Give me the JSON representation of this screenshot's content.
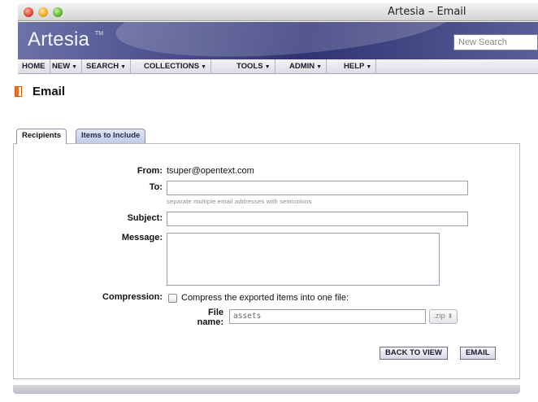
{
  "window": {
    "title": "Artesia – Email"
  },
  "banner": {
    "logo": "Artesia",
    "logo_tm": "TM",
    "search_placeholder": "New Search"
  },
  "menu": [
    {
      "label": "HOME",
      "caret": ""
    },
    {
      "label": "NEW",
      "caret": "▼"
    },
    {
      "label": "SEARCH",
      "caret": "▼"
    },
    {
      "label": "COLLECTIONS",
      "caret": "▼"
    },
    {
      "label": "TOOLS",
      "caret": "▼"
    },
    {
      "label": "ADMIN",
      "caret": "▼"
    },
    {
      "label": "HELP",
      "caret": "▼"
    }
  ],
  "page": {
    "title": "Email"
  },
  "tabs": [
    {
      "label": "Recipients",
      "active": true
    },
    {
      "label": "Items to Include",
      "active": false
    }
  ],
  "form": {
    "from_label": "From:",
    "from_value": "tsuper@opentext.com",
    "to_label": "To:",
    "to_value": "",
    "to_hint": "separate multiple email addresses with semicolons",
    "subject_label": "Subject:",
    "subject_value": "",
    "message_label": "Message:",
    "message_value": "",
    "compression_label": "Compression:",
    "compression_checked": false,
    "compression_text": "Compress the exported items into one file:",
    "filename_label_1": "File",
    "filename_label_2": "name:",
    "filename_value": "assets",
    "extension": ".zip",
    "extension_arrows": "⬍"
  },
  "buttons": {
    "back": "BACK TO VIEW",
    "email": "EMAIL"
  }
}
